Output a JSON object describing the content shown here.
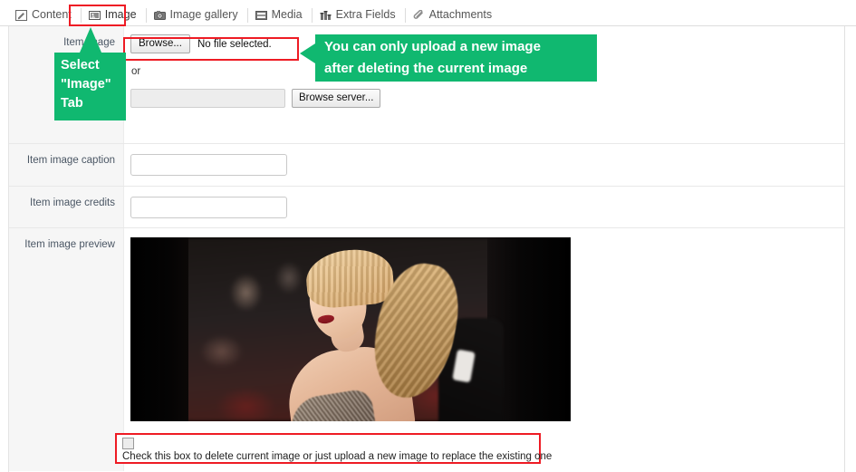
{
  "tabs": [
    {
      "label": "Content",
      "icon": "pencil-square-icon",
      "active": false
    },
    {
      "label": "Image",
      "icon": "image-icon",
      "active": true
    },
    {
      "label": "Image gallery",
      "icon": "camera-icon",
      "active": false
    },
    {
      "label": "Media",
      "icon": "film-icon",
      "active": false
    },
    {
      "label": "Extra Fields",
      "icon": "sliders-icon",
      "active": false
    },
    {
      "label": "Attachments",
      "icon": "paperclip-icon",
      "active": false
    }
  ],
  "form": {
    "image_row": {
      "label": "Item image",
      "browse_button": "Browse...",
      "file_status": "No file selected.",
      "or_text": "or",
      "server_input_value": "",
      "server_input_placeholder": "",
      "browse_server_button": "Browse server..."
    },
    "caption_row": {
      "label": "Item image caption",
      "value": "",
      "placeholder": ""
    },
    "credits_row": {
      "label": "Item image credits",
      "value": "",
      "placeholder": ""
    },
    "preview_row": {
      "label": "Item image preview",
      "image_alt": "Blonde woman on red carpet with photographers in background"
    }
  },
  "delete_control": {
    "checked": false,
    "text": "Check this box to delete current image or just upload a new image to replace the existing one"
  },
  "annotations": {
    "left_callout": {
      "line1": "Select",
      "line2": "\"Image\"",
      "line3": "Tab"
    },
    "right_callout": {
      "line1": "You can only upload a new image",
      "line2": "after deleting the current image"
    }
  },
  "colors": {
    "annotation_green": "#10b870",
    "highlight_red": "#ee1b24",
    "label_background": "#f6f6f6",
    "label_text": "#4a5664"
  }
}
